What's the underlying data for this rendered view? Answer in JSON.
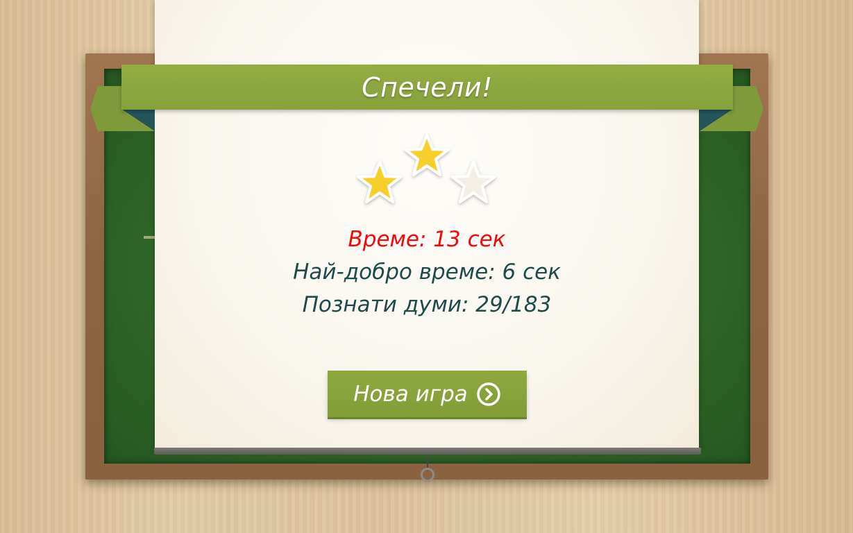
{
  "dialog": {
    "title": "Спечели!",
    "stars": {
      "earned": 2,
      "total": 3
    },
    "time_text": "Време: 13 сек",
    "best_time_text": "Най-добро време: 6 сек",
    "known_words_text": "Познати думи: 29/183"
  },
  "new_game_button": {
    "label": "Нова игра",
    "icon": "chevron-right-circle-icon"
  },
  "colors": {
    "ribbon": "#8aa53e",
    "time_text": "#f00a0a",
    "stats_text": "#1f4a4c",
    "star_filled": "#f6cf2a",
    "star_empty": "#f3efe6",
    "board": "#2f6628"
  }
}
